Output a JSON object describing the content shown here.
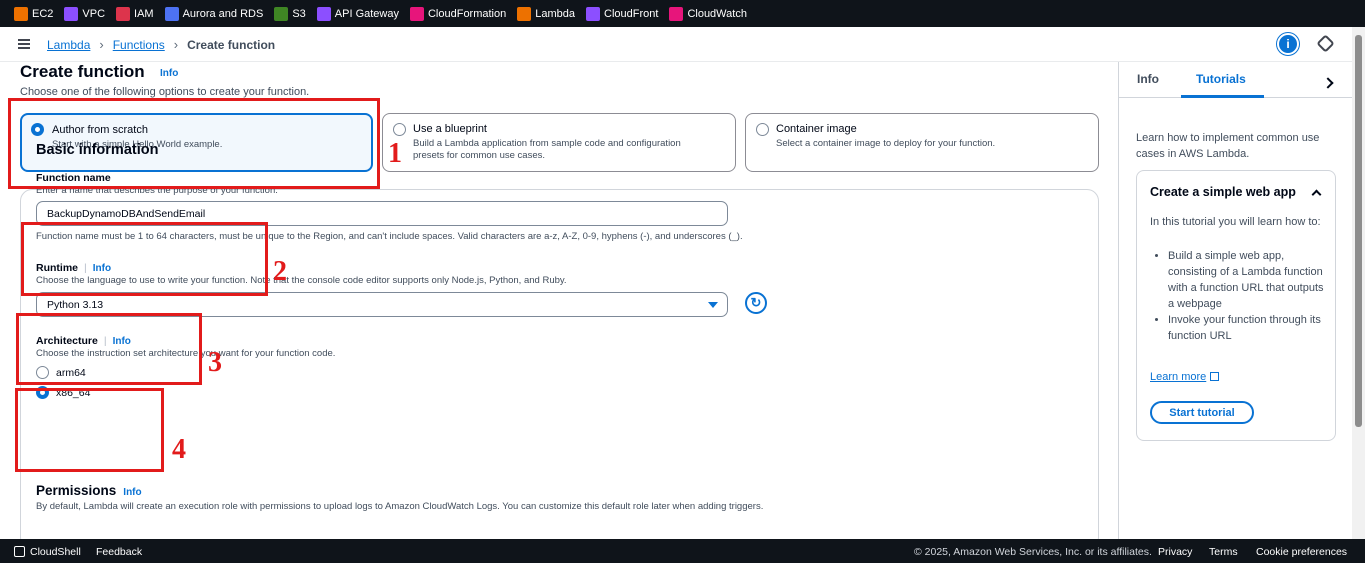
{
  "services": [
    {
      "label": "EC2",
      "color": "#ed7100"
    },
    {
      "label": "VPC",
      "color": "#8c4fff"
    },
    {
      "label": "IAM",
      "color": "#dd344c"
    },
    {
      "label": "Aurora and RDS",
      "color": "#4d72f3"
    },
    {
      "label": "S3",
      "color": "#3f8624"
    },
    {
      "label": "API Gateway",
      "color": "#8c4fff"
    },
    {
      "label": "CloudFormation",
      "color": "#e7157b"
    },
    {
      "label": "Lambda",
      "color": "#ed7100"
    },
    {
      "label": "CloudFront",
      "color": "#8c4fff"
    },
    {
      "label": "CloudWatch",
      "color": "#e7157b"
    }
  ],
  "breadcrumb": {
    "lambda": "Lambda",
    "functions": "Functions",
    "current": "Create function"
  },
  "header": {
    "info_icon": "i"
  },
  "page": {
    "title": "Create function",
    "title_info": "Info",
    "subtitle": "Choose one of the following options to create your function."
  },
  "options": {
    "author": {
      "title": "Author from scratch",
      "desc": "Start with a simple Hello World example."
    },
    "blueprint": {
      "title": "Use a blueprint",
      "desc": "Build a Lambda application from sample code and configuration presets for common use cases."
    },
    "container": {
      "title": "Container image",
      "desc": "Select a container image to deploy for your function."
    }
  },
  "basic": {
    "heading": "Basic information",
    "function_name_label": "Function name",
    "function_name_desc": "Enter a name that describes the purpose of your function.",
    "function_name_value": "BackupDynamoDBAndSendEmail",
    "function_name_constraint": "Function name must be 1 to 64 characters, must be unique to the Region, and can't include spaces. Valid characters are a-z, A-Z, 0-9, hyphens (-), and underscores (_).",
    "runtime_label": "Runtime",
    "runtime_info": "Info",
    "runtime_desc": "Choose the language to use to write your function. Note that the console code editor supports only Node.js, Python, and Ruby.",
    "runtime_value": "Python 3.13",
    "arch_label": "Architecture",
    "arch_info": "Info",
    "arch_desc": "Choose the instruction set architecture you want for your function code.",
    "arch_option1": "arm64",
    "arch_option2": "x86_64",
    "permissions_label": "Permissions",
    "permissions_info": "Info",
    "permissions_desc": "By default, Lambda will create an execution role with permissions to upload logs to Amazon CloudWatch Logs. You can customize this default role later when adding triggers."
  },
  "annotations": [
    "1",
    "2",
    "3",
    "4"
  ],
  "side": {
    "tab_info": "Info",
    "tab_tutorials": "Tutorials",
    "intro": "Learn how to implement common use cases in AWS Lambda.",
    "tutorial_title": "Create a simple web app",
    "tutorial_body": "In this tutorial you will learn how to:",
    "tutorial_item1": "Build a simple web app, consisting of a Lambda function with a function URL that outputs a webpage",
    "tutorial_item2": "Invoke your function through its function URL",
    "learn_more": "Learn more",
    "start_tutorial": "Start tutorial"
  },
  "footer": {
    "cloudshell": "CloudShell",
    "feedback": "Feedback",
    "copyright": "© 2025, Amazon Web Services, Inc. or its affiliates.",
    "privacy": "Privacy",
    "terms": "Terms",
    "cookies": "Cookie preferences"
  }
}
